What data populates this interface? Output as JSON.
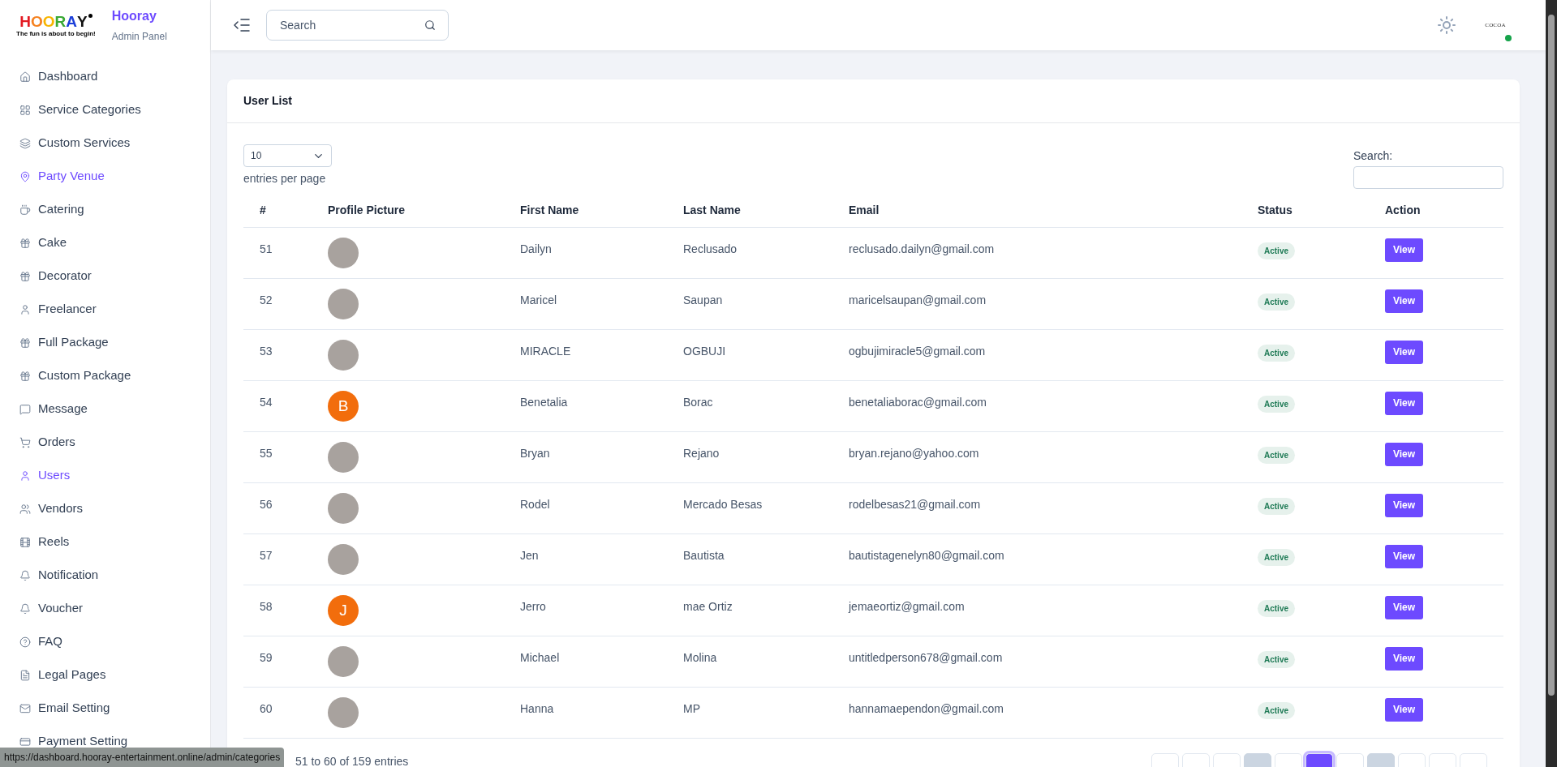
{
  "brand": {
    "logo_letters": [
      {
        "char": "H",
        "color": "#e31b23"
      },
      {
        "char": "O",
        "color": "#f58220"
      },
      {
        "char": "O",
        "color": "#f7b500"
      },
      {
        "char": "R",
        "color": "#3aa935"
      },
      {
        "char": "A",
        "color": "#1c3fd9"
      },
      {
        "char": "Y",
        "color": "#111111"
      }
    ],
    "tagline": "The fun is about to begin!",
    "title": "Hooray",
    "subtitle": "Admin Panel"
  },
  "sidebar": {
    "items": [
      {
        "label": "Dashboard",
        "selected": false
      },
      {
        "label": "Service Categories",
        "selected": false
      },
      {
        "label": "Custom Services",
        "selected": false
      },
      {
        "label": "Party Venue",
        "selected": true
      },
      {
        "label": "Catering",
        "selected": false
      },
      {
        "label": "Cake",
        "selected": false
      },
      {
        "label": "Decorator",
        "selected": false
      },
      {
        "label": "Freelancer",
        "selected": false
      },
      {
        "label": "Full Package",
        "selected": false
      },
      {
        "label": "Custom Package",
        "selected": false
      },
      {
        "label": "Message",
        "selected": false
      },
      {
        "label": "Orders",
        "selected": false
      },
      {
        "label": "Users",
        "selected": true
      },
      {
        "label": "Vendors",
        "selected": false
      },
      {
        "label": "Reels",
        "selected": false
      },
      {
        "label": "Notification",
        "selected": false
      },
      {
        "label": "Voucher",
        "selected": false
      },
      {
        "label": "FAQ",
        "selected": false
      },
      {
        "label": "Legal Pages",
        "selected": false
      },
      {
        "label": "Email Setting",
        "selected": false
      },
      {
        "label": "Payment Setting",
        "selected": false
      }
    ]
  },
  "header": {
    "search": {
      "placeholder": "Search"
    },
    "profile": {
      "logo_text": "COCOA",
      "online": true
    }
  },
  "card": {
    "title": "User List",
    "entries_select": {
      "value": "10"
    },
    "entries_label": "entries per page",
    "search_label": "Search:",
    "table": {
      "columns": [
        "#",
        "Profile Picture",
        "First Name",
        "Last Name",
        "Email",
        "Status",
        "Action"
      ],
      "rows": [
        {
          "no": "51",
          "avatar": {
            "kind": "photo"
          },
          "first_name": "Dailyn",
          "last_name": "Reclusado",
          "email": "reclusado.dailyn@gmail.com",
          "status": "Active",
          "action": "View"
        },
        {
          "no": "52",
          "avatar": {
            "kind": "photo"
          },
          "first_name": "Maricel",
          "last_name": "Saupan",
          "email": "maricelsaupan@gmail.com",
          "status": "Active",
          "action": "View"
        },
        {
          "no": "53",
          "avatar": {
            "kind": "photo"
          },
          "first_name": "MIRACLE",
          "last_name": "OGBUJI",
          "email": "ogbujimiracle5@gmail.com",
          "status": "Active",
          "action": "View"
        },
        {
          "no": "54",
          "avatar": {
            "kind": "letter",
            "letter": "B"
          },
          "first_name": "Benetalia",
          "last_name": "Borac",
          "email": "benetaliaborac@gmail.com",
          "status": "Active",
          "action": "View"
        },
        {
          "no": "55",
          "avatar": {
            "kind": "photo"
          },
          "first_name": "Bryan",
          "last_name": "Rejano",
          "email": "bryan.rejano@yahoo.com",
          "status": "Active",
          "action": "View"
        },
        {
          "no": "56",
          "avatar": {
            "kind": "photo"
          },
          "first_name": "Rodel",
          "last_name": "Mercado Besas",
          "email": "rodelbesas21@gmail.com",
          "status": "Active",
          "action": "View"
        },
        {
          "no": "57",
          "avatar": {
            "kind": "photo"
          },
          "first_name": "Jen",
          "last_name": "Bautista",
          "email": "bautistagenelyn80@gmail.com",
          "status": "Active",
          "action": "View"
        },
        {
          "no": "58",
          "avatar": {
            "kind": "letter",
            "letter": "J"
          },
          "first_name": "Jerro",
          "last_name": "mae Ortiz",
          "email": "jemaeortiz@gmail.com",
          "status": "Active",
          "action": "View"
        },
        {
          "no": "59",
          "avatar": {
            "kind": "photo"
          },
          "first_name": "Michael",
          "last_name": "Molina",
          "email": "untitledperson678@gmail.com",
          "status": "Active",
          "action": "View"
        },
        {
          "no": "60",
          "avatar": {
            "kind": "photo"
          },
          "first_name": "Hanna",
          "last_name": "MP",
          "email": "hannamaependon@gmail.com",
          "status": "Active",
          "action": "View"
        }
      ]
    },
    "footer_info": "51 to 60 of 159 entries",
    "pagination": [
      {
        "selected": false,
        "shaded": false
      },
      {
        "selected": false,
        "shaded": false
      },
      {
        "selected": false,
        "shaded": false
      },
      {
        "selected": false,
        "shaded": true
      },
      {
        "selected": false,
        "shaded": false
      },
      {
        "selected": true,
        "shaded": false
      },
      {
        "selected": false,
        "shaded": false
      },
      {
        "selected": false,
        "shaded": true
      },
      {
        "selected": false,
        "shaded": false
      },
      {
        "selected": false,
        "shaded": false
      },
      {
        "selected": false,
        "shaded": false
      }
    ]
  },
  "status_url": "https://dashboard.hooray-entertainment.online/admin/categories"
}
